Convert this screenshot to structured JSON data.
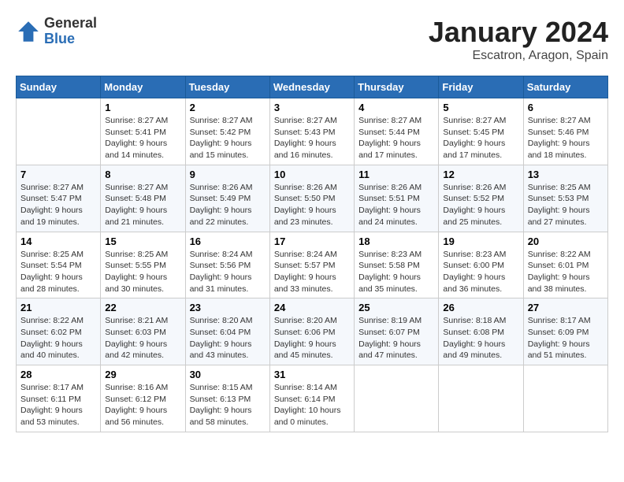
{
  "header": {
    "logo": {
      "general": "General",
      "blue": "Blue"
    },
    "title": "January 2024",
    "subtitle": "Escatron, Aragon, Spain"
  },
  "days_of_week": [
    "Sunday",
    "Monday",
    "Tuesday",
    "Wednesday",
    "Thursday",
    "Friday",
    "Saturday"
  ],
  "weeks": [
    [
      {
        "day": "",
        "sunrise": "",
        "sunset": "",
        "daylight": ""
      },
      {
        "day": "1",
        "sunrise": "Sunrise: 8:27 AM",
        "sunset": "Sunset: 5:41 PM",
        "daylight": "Daylight: 9 hours and 14 minutes."
      },
      {
        "day": "2",
        "sunrise": "Sunrise: 8:27 AM",
        "sunset": "Sunset: 5:42 PM",
        "daylight": "Daylight: 9 hours and 15 minutes."
      },
      {
        "day": "3",
        "sunrise": "Sunrise: 8:27 AM",
        "sunset": "Sunset: 5:43 PM",
        "daylight": "Daylight: 9 hours and 16 minutes."
      },
      {
        "day": "4",
        "sunrise": "Sunrise: 8:27 AM",
        "sunset": "Sunset: 5:44 PM",
        "daylight": "Daylight: 9 hours and 17 minutes."
      },
      {
        "day": "5",
        "sunrise": "Sunrise: 8:27 AM",
        "sunset": "Sunset: 5:45 PM",
        "daylight": "Daylight: 9 hours and 17 minutes."
      },
      {
        "day": "6",
        "sunrise": "Sunrise: 8:27 AM",
        "sunset": "Sunset: 5:46 PM",
        "daylight": "Daylight: 9 hours and 18 minutes."
      }
    ],
    [
      {
        "day": "7",
        "sunrise": "Sunrise: 8:27 AM",
        "sunset": "Sunset: 5:47 PM",
        "daylight": "Daylight: 9 hours and 19 minutes."
      },
      {
        "day": "8",
        "sunrise": "Sunrise: 8:27 AM",
        "sunset": "Sunset: 5:48 PM",
        "daylight": "Daylight: 9 hours and 21 minutes."
      },
      {
        "day": "9",
        "sunrise": "Sunrise: 8:26 AM",
        "sunset": "Sunset: 5:49 PM",
        "daylight": "Daylight: 9 hours and 22 minutes."
      },
      {
        "day": "10",
        "sunrise": "Sunrise: 8:26 AM",
        "sunset": "Sunset: 5:50 PM",
        "daylight": "Daylight: 9 hours and 23 minutes."
      },
      {
        "day": "11",
        "sunrise": "Sunrise: 8:26 AM",
        "sunset": "Sunset: 5:51 PM",
        "daylight": "Daylight: 9 hours and 24 minutes."
      },
      {
        "day": "12",
        "sunrise": "Sunrise: 8:26 AM",
        "sunset": "Sunset: 5:52 PM",
        "daylight": "Daylight: 9 hours and 25 minutes."
      },
      {
        "day": "13",
        "sunrise": "Sunrise: 8:25 AM",
        "sunset": "Sunset: 5:53 PM",
        "daylight": "Daylight: 9 hours and 27 minutes."
      }
    ],
    [
      {
        "day": "14",
        "sunrise": "Sunrise: 8:25 AM",
        "sunset": "Sunset: 5:54 PM",
        "daylight": "Daylight: 9 hours and 28 minutes."
      },
      {
        "day": "15",
        "sunrise": "Sunrise: 8:25 AM",
        "sunset": "Sunset: 5:55 PM",
        "daylight": "Daylight: 9 hours and 30 minutes."
      },
      {
        "day": "16",
        "sunrise": "Sunrise: 8:24 AM",
        "sunset": "Sunset: 5:56 PM",
        "daylight": "Daylight: 9 hours and 31 minutes."
      },
      {
        "day": "17",
        "sunrise": "Sunrise: 8:24 AM",
        "sunset": "Sunset: 5:57 PM",
        "daylight": "Daylight: 9 hours and 33 minutes."
      },
      {
        "day": "18",
        "sunrise": "Sunrise: 8:23 AM",
        "sunset": "Sunset: 5:58 PM",
        "daylight": "Daylight: 9 hours and 35 minutes."
      },
      {
        "day": "19",
        "sunrise": "Sunrise: 8:23 AM",
        "sunset": "Sunset: 6:00 PM",
        "daylight": "Daylight: 9 hours and 36 minutes."
      },
      {
        "day": "20",
        "sunrise": "Sunrise: 8:22 AM",
        "sunset": "Sunset: 6:01 PM",
        "daylight": "Daylight: 9 hours and 38 minutes."
      }
    ],
    [
      {
        "day": "21",
        "sunrise": "Sunrise: 8:22 AM",
        "sunset": "Sunset: 6:02 PM",
        "daylight": "Daylight: 9 hours and 40 minutes."
      },
      {
        "day": "22",
        "sunrise": "Sunrise: 8:21 AM",
        "sunset": "Sunset: 6:03 PM",
        "daylight": "Daylight: 9 hours and 42 minutes."
      },
      {
        "day": "23",
        "sunrise": "Sunrise: 8:20 AM",
        "sunset": "Sunset: 6:04 PM",
        "daylight": "Daylight: 9 hours and 43 minutes."
      },
      {
        "day": "24",
        "sunrise": "Sunrise: 8:20 AM",
        "sunset": "Sunset: 6:06 PM",
        "daylight": "Daylight: 9 hours and 45 minutes."
      },
      {
        "day": "25",
        "sunrise": "Sunrise: 8:19 AM",
        "sunset": "Sunset: 6:07 PM",
        "daylight": "Daylight: 9 hours and 47 minutes."
      },
      {
        "day": "26",
        "sunrise": "Sunrise: 8:18 AM",
        "sunset": "Sunset: 6:08 PM",
        "daylight": "Daylight: 9 hours and 49 minutes."
      },
      {
        "day": "27",
        "sunrise": "Sunrise: 8:17 AM",
        "sunset": "Sunset: 6:09 PM",
        "daylight": "Daylight: 9 hours and 51 minutes."
      }
    ],
    [
      {
        "day": "28",
        "sunrise": "Sunrise: 8:17 AM",
        "sunset": "Sunset: 6:11 PM",
        "daylight": "Daylight: 9 hours and 53 minutes."
      },
      {
        "day": "29",
        "sunrise": "Sunrise: 8:16 AM",
        "sunset": "Sunset: 6:12 PM",
        "daylight": "Daylight: 9 hours and 56 minutes."
      },
      {
        "day": "30",
        "sunrise": "Sunrise: 8:15 AM",
        "sunset": "Sunset: 6:13 PM",
        "daylight": "Daylight: 9 hours and 58 minutes."
      },
      {
        "day": "31",
        "sunrise": "Sunrise: 8:14 AM",
        "sunset": "Sunset: 6:14 PM",
        "daylight": "Daylight: 10 hours and 0 minutes."
      },
      {
        "day": "",
        "sunrise": "",
        "sunset": "",
        "daylight": ""
      },
      {
        "day": "",
        "sunrise": "",
        "sunset": "",
        "daylight": ""
      },
      {
        "day": "",
        "sunrise": "",
        "sunset": "",
        "daylight": ""
      }
    ]
  ]
}
